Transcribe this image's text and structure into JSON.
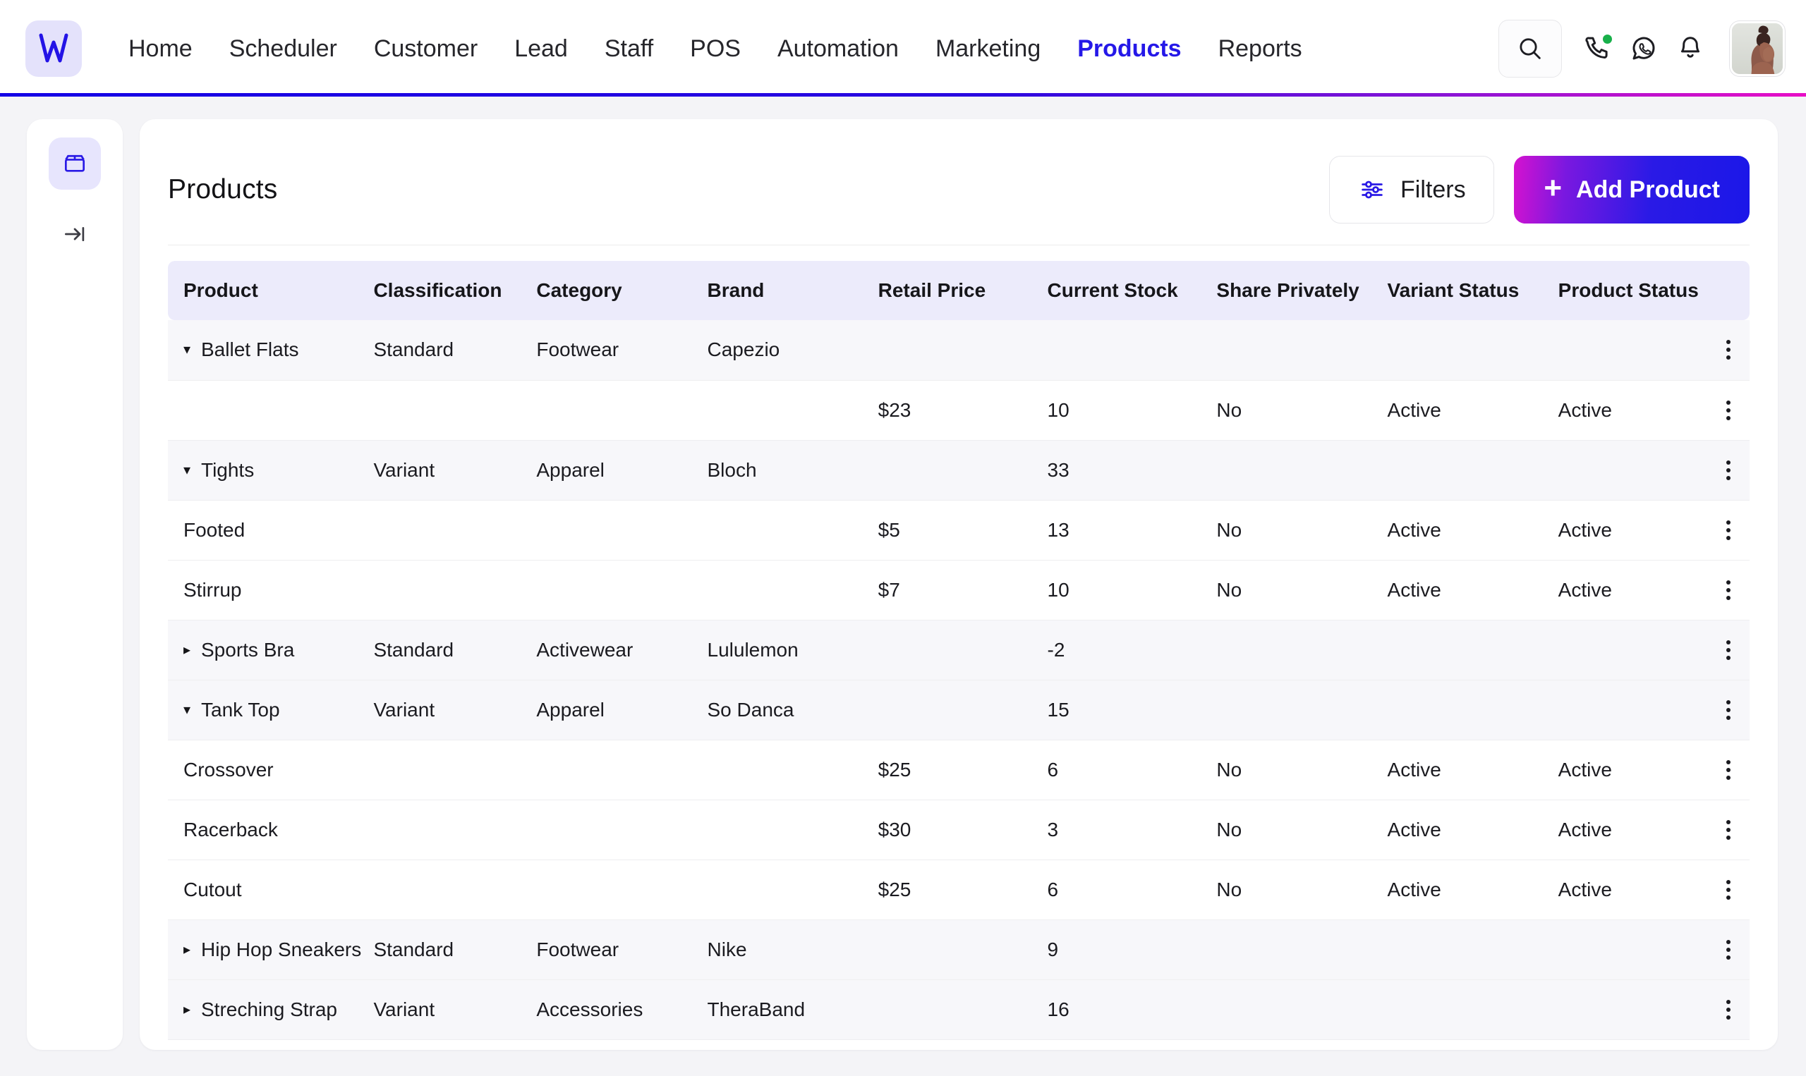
{
  "nav": {
    "logo_alt": "W",
    "items": [
      {
        "label": "Home",
        "active": false
      },
      {
        "label": "Scheduler",
        "active": false
      },
      {
        "label": "Customer",
        "active": false
      },
      {
        "label": "Lead",
        "active": false
      },
      {
        "label": "Staff",
        "active": false
      },
      {
        "label": "POS",
        "active": false
      },
      {
        "label": "Automation",
        "active": false
      },
      {
        "label": "Marketing",
        "active": false
      },
      {
        "label": "Products",
        "active": true
      },
      {
        "label": "Reports",
        "active": false
      }
    ],
    "icons": {
      "search": "search-icon",
      "call": "phone-call-icon",
      "whatsapp": "whatsapp-icon",
      "notifications": "bell-icon",
      "avatar": "user-avatar"
    },
    "call_status_color": "#18b04a",
    "accent_color": "#2518e8",
    "gradient_from": "#1400e6",
    "gradient_to": "#e80ec6"
  },
  "rail": {
    "items": [
      {
        "name": "products",
        "icon": "box-icon",
        "active": true
      },
      {
        "name": "collapse",
        "icon": "collapse-panel-icon",
        "active": false
      }
    ]
  },
  "header": {
    "title": "Products",
    "filters_label": "Filters",
    "add_label": "Add Product",
    "add_plus": "+"
  },
  "table": {
    "columns": [
      "Product",
      "Classification",
      "Category",
      "Brand",
      "Retail Price",
      "Current Stock",
      "Share Privately",
      "Variant Status",
      "Product Status"
    ],
    "rows": [
      {
        "type": "parent",
        "expanded": true,
        "caret": "▾",
        "product": "Ballet Flats",
        "classification": "Standard",
        "category": "Footwear",
        "brand": "Capezio",
        "retail_price": "",
        "current_stock": "",
        "share_privately": "",
        "variant_status": "",
        "product_status": ""
      },
      {
        "type": "child",
        "expanded": null,
        "caret": "",
        "product": "",
        "classification": "",
        "category": "",
        "brand": "",
        "retail_price": "$23",
        "current_stock": "10",
        "share_privately": "No",
        "variant_status": "Active",
        "product_status": "Active"
      },
      {
        "type": "parent",
        "expanded": true,
        "caret": "▾",
        "product": "Tights",
        "classification": "Variant",
        "category": "Apparel",
        "brand": "Bloch",
        "retail_price": "",
        "current_stock": "33",
        "share_privately": "",
        "variant_status": "",
        "product_status": ""
      },
      {
        "type": "child",
        "expanded": null,
        "caret": "",
        "product": "Footed",
        "classification": "",
        "category": "",
        "brand": "",
        "retail_price": "$5",
        "current_stock": "13",
        "share_privately": "No",
        "variant_status": "Active",
        "product_status": "Active"
      },
      {
        "type": "child",
        "expanded": null,
        "caret": "",
        "product": "Stirrup",
        "classification": "",
        "category": "",
        "brand": "",
        "retail_price": "$7",
        "current_stock": "10",
        "share_privately": "No",
        "variant_status": "Active",
        "product_status": "Active"
      },
      {
        "type": "parent",
        "expanded": false,
        "caret": "▸",
        "product": "Sports Bra",
        "classification": "Standard",
        "category": "Activewear",
        "brand": "Lululemon",
        "retail_price": "",
        "current_stock": "-2",
        "share_privately": "",
        "variant_status": "",
        "product_status": ""
      },
      {
        "type": "parent",
        "expanded": true,
        "caret": "▾",
        "product": "Tank Top",
        "classification": "Variant",
        "category": "Apparel",
        "brand": "So Danca",
        "retail_price": "",
        "current_stock": "15",
        "share_privately": "",
        "variant_status": "",
        "product_status": ""
      },
      {
        "type": "child",
        "expanded": null,
        "caret": "",
        "product": "Crossover",
        "classification": "",
        "category": "",
        "brand": "",
        "retail_price": "$25",
        "current_stock": "6",
        "share_privately": "No",
        "variant_status": "Active",
        "product_status": "Active"
      },
      {
        "type": "child",
        "expanded": null,
        "caret": "",
        "product": "Racerback",
        "classification": "",
        "category": "",
        "brand": "",
        "retail_price": "$30",
        "current_stock": "3",
        "share_privately": "No",
        "variant_status": "Active",
        "product_status": "Active"
      },
      {
        "type": "child",
        "expanded": null,
        "caret": "",
        "product": "Cutout",
        "classification": "",
        "category": "",
        "brand": "",
        "retail_price": "$25",
        "current_stock": "6",
        "share_privately": "No",
        "variant_status": "Active",
        "product_status": "Active"
      },
      {
        "type": "parent",
        "expanded": false,
        "caret": "▸",
        "product": "Hip Hop Sneakers",
        "classification": "Standard",
        "category": "Footwear",
        "brand": "Nike",
        "retail_price": "",
        "current_stock": "9",
        "share_privately": "",
        "variant_status": "",
        "product_status": ""
      },
      {
        "type": "parent",
        "expanded": false,
        "caret": "▸",
        "product": "Streching Strap",
        "classification": "Variant",
        "category": "Accessories",
        "brand": "TheraBand",
        "retail_price": "",
        "current_stock": "16",
        "share_privately": "",
        "variant_status": "",
        "product_status": ""
      }
    ]
  }
}
